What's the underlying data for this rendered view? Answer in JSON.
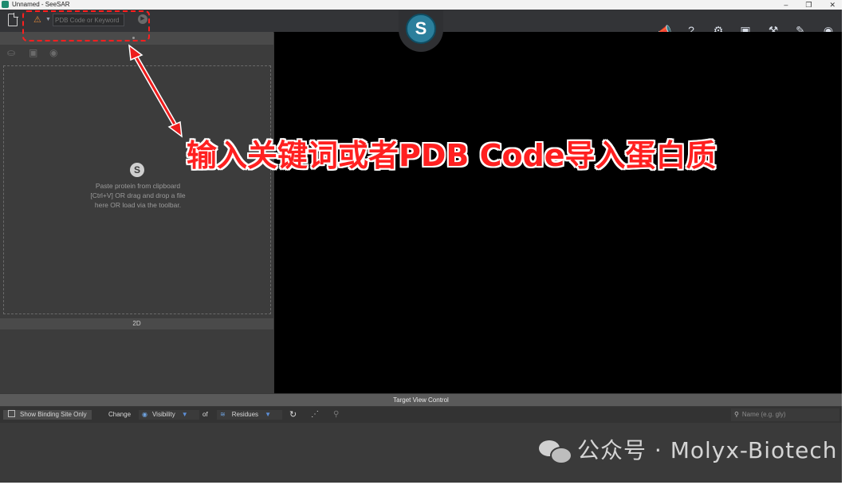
{
  "window": {
    "title": "Unnamed - SeeSAR",
    "controls": [
      "–",
      "❐",
      "✕"
    ]
  },
  "toolbar": {
    "search_placeholder": "PDB Code or Keyword",
    "icons": [
      "new-file-icon",
      "warning-icon",
      "go-icon",
      "seesar-logo-icon",
      "announcement-icon",
      "help-icon",
      "settings-icon",
      "display-icon",
      "tools-icon",
      "measure-icon",
      "visibility-icon"
    ],
    "logo_letter": "S"
  },
  "left_panel": {
    "drop_text": "Paste protein from clipboard [Ctrl+V] OR drag and drop a file here OR load via the toolbar.",
    "view_label": "2D"
  },
  "target_view": {
    "header": "Target View Control",
    "show_binding_site": "Show Binding Site Only",
    "change_label": "Change",
    "visibility_label": "Visibility",
    "of_label": "of",
    "residues_label": "Residues",
    "name_search_placeholder": "Name (e.g. gly)"
  },
  "annotation": {
    "text": "输入关键词或者PDB Code导入蛋白质",
    "color": "#ff2020"
  },
  "watermark": {
    "text": "公众号 · Molyx-Biotech"
  },
  "colors": {
    "accent": "#2b7f9c",
    "highlight": "#ff1f1f",
    "warning": "#e0883a"
  }
}
